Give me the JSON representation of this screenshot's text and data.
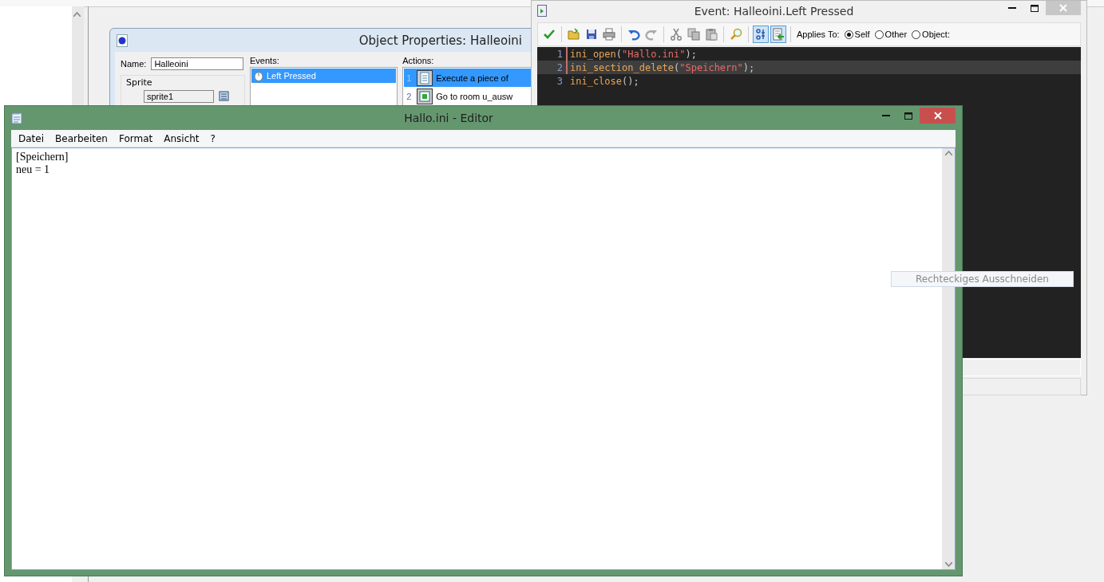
{
  "object_properties": {
    "title": "Object Properties: Halleoini",
    "name_label": "Name:",
    "name_value": "Halleoini",
    "sprite_group": "Sprite",
    "sprite_value": "sprite1",
    "events_label": "Events:",
    "events": [
      {
        "label": "Left Pressed",
        "selected": true
      }
    ],
    "actions_label": "Actions:",
    "actions": [
      {
        "number": "1",
        "kind": "code",
        "text": "Execute a piece of",
        "selected": true
      },
      {
        "number": "2",
        "kind": "room",
        "text": "Go to room u_ausw",
        "selected": false
      }
    ]
  },
  "event_window": {
    "title": "Event: Halleoini.Left Pressed",
    "toolbar": [
      {
        "kind": "check"
      },
      {
        "kind": "separator"
      },
      {
        "kind": "open"
      },
      {
        "kind": "save"
      },
      {
        "kind": "print"
      },
      {
        "kind": "separator"
      },
      {
        "kind": "undo"
      },
      {
        "kind": "redo"
      },
      {
        "kind": "separator"
      },
      {
        "kind": "cut"
      },
      {
        "kind": "copy"
      },
      {
        "kind": "paste"
      },
      {
        "kind": "separator"
      },
      {
        "kind": "find"
      },
      {
        "kind": "separator"
      }
    ],
    "toggles": [
      {
        "kind": "tree",
        "pressed": true
      },
      {
        "kind": "insert",
        "pressed": true
      }
    ],
    "applies_to_label": "Applies To:",
    "applies_to": [
      {
        "label": "Self",
        "selected": true
      },
      {
        "label": "Other",
        "selected": false
      },
      {
        "label": "Object:",
        "selected": false
      }
    ],
    "code": [
      {
        "number": "1",
        "current": false,
        "changed": true,
        "tokens": [
          {
            "kind": "fn",
            "text": "ini_open"
          },
          {
            "kind": "punct",
            "text": "("
          },
          {
            "kind": "string",
            "text": "\"Hallo.ini\""
          },
          {
            "kind": "punct",
            "text": ");"
          }
        ]
      },
      {
        "number": "2",
        "current": true,
        "changed": true,
        "tokens": [
          {
            "kind": "fn",
            "text": "ini_section_delete"
          },
          {
            "kind": "punct",
            "text": "("
          },
          {
            "kind": "string",
            "text": "\"Speichern\""
          },
          {
            "kind": "punct",
            "text": ");"
          }
        ]
      },
      {
        "number": "3",
        "current": false,
        "changed": false,
        "tokens": [
          {
            "kind": "fn",
            "text": "ini_close"
          },
          {
            "kind": "punct",
            "text": "();"
          }
        ]
      }
    ]
  },
  "notepad": {
    "title": "Hallo.ini - Editor",
    "menu": [
      "Datei",
      "Bearbeiten",
      "Format",
      "Ansicht",
      "?"
    ],
    "lines": [
      "[Speichern]",
      "neu = 1"
    ]
  },
  "tooltip": {
    "text": "Rechteckiges Ausschneiden"
  }
}
